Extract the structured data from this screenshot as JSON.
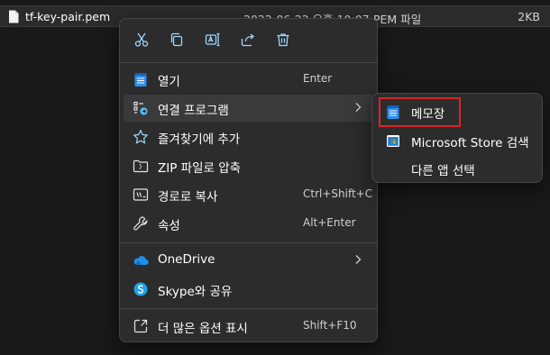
{
  "file_row": {
    "name": "tf-key-pair.pem",
    "date": "2022-06-22 오후 10:07",
    "type": "PEM 파일",
    "size": "2KB",
    "icon": "file-icon"
  },
  "quick_actions": [
    {
      "name": "cut",
      "icon": "scissors-icon"
    },
    {
      "name": "copy",
      "icon": "copy-icon"
    },
    {
      "name": "rename",
      "icon": "rename-icon"
    },
    {
      "name": "share",
      "icon": "share-icon"
    },
    {
      "name": "delete",
      "icon": "trash-icon"
    }
  ],
  "menu": {
    "open": {
      "label": "열기",
      "shortcut": "Enter",
      "icon": "notepad-icon"
    },
    "open_with": {
      "label": "연결 프로그램",
      "icon": "open-with-icon"
    },
    "favorites": {
      "label": "즐겨찾기에 추가",
      "icon": "star-icon"
    },
    "zip": {
      "label": "ZIP 파일로 압축",
      "icon": "zip-folder-icon"
    },
    "copy_path": {
      "label": "경로로 복사",
      "shortcut": "Ctrl+Shift+C",
      "icon": "copy-path-icon"
    },
    "properties": {
      "label": "속성",
      "shortcut": "Alt+Enter",
      "icon": "wrench-icon"
    },
    "onedrive": {
      "label": "OneDrive",
      "icon": "onedrive-icon"
    },
    "skype": {
      "label": "Skype와 공유",
      "icon": "skype-icon"
    },
    "more_options": {
      "label": "더 많은 옵션 표시",
      "shortcut": "Shift+F10",
      "icon": "more-options-icon"
    }
  },
  "submenu": {
    "notepad": {
      "label": "메모장",
      "icon": "notepad-icon"
    },
    "store": {
      "label": "Microsoft Store 검색",
      "icon": "store-icon"
    },
    "other_app": {
      "label": "다른 앱 선택"
    }
  },
  "colors": {
    "accent": "#4cc2ff",
    "notepad_blue": "#1a8cff",
    "highlight_red": "#d6262a",
    "menu_bg": "#2c2c2c"
  }
}
